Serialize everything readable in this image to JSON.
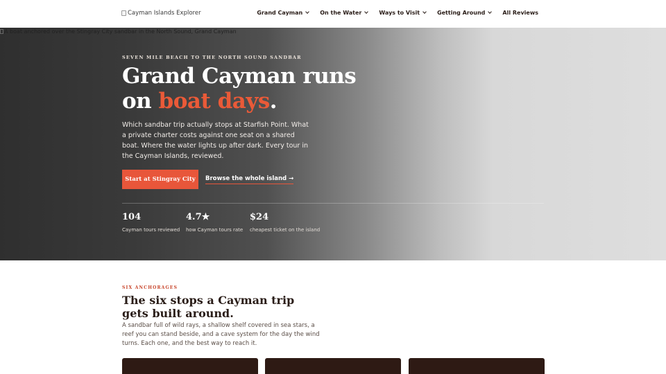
{
  "header": {
    "logo_alt": "Cayman Islands Explorer",
    "nav": [
      {
        "label": "Grand Cayman",
        "dropdown": true
      },
      {
        "label": "On the Water",
        "dropdown": true
      },
      {
        "label": "Ways to Visit",
        "dropdown": true
      },
      {
        "label": "Getting Around",
        "dropdown": true
      },
      {
        "label": "All Reviews",
        "dropdown": false
      }
    ]
  },
  "hero": {
    "image_alt": "A boat anchored over the Stingray City sandbar in the North Sound, Grand Cayman",
    "eyebrow": "SEVEN MILE BEACH TO THE NORTH SOUND SANDBAR",
    "title_part1": "Grand Cayman runs on ",
    "title_accent": "boat days",
    "title_end": ".",
    "description": "Which sandbar trip actually stops at Starfish Point. What a private charter costs against one seat on a shared boat. Where the water lights up after dark. Every tour in the Cayman Islands, reviewed.",
    "primary_cta": "Start at Stingray City",
    "secondary_cta": "Browse the whole island →",
    "stats": [
      {
        "value": "104",
        "label": "Cayman tours reviewed"
      },
      {
        "value": "4.7★",
        "label": "how Cayman tours rate"
      },
      {
        "value": "$24",
        "label": "cheapest ticket on the island"
      }
    ]
  },
  "stops": {
    "kicker": "SIX ANCHORAGES",
    "title": "The six stops a Cayman trip gets built around.",
    "description": "A sandbar full of wild rays, a shallow shelf covered in sea stars, a reef you can stand beside, and a cave system for the day the wind turns. Each one, and the best way to reach it."
  },
  "colors": {
    "accent": "#e8563a",
    "dark": "#2a1d18",
    "card": "#2e1a14"
  }
}
